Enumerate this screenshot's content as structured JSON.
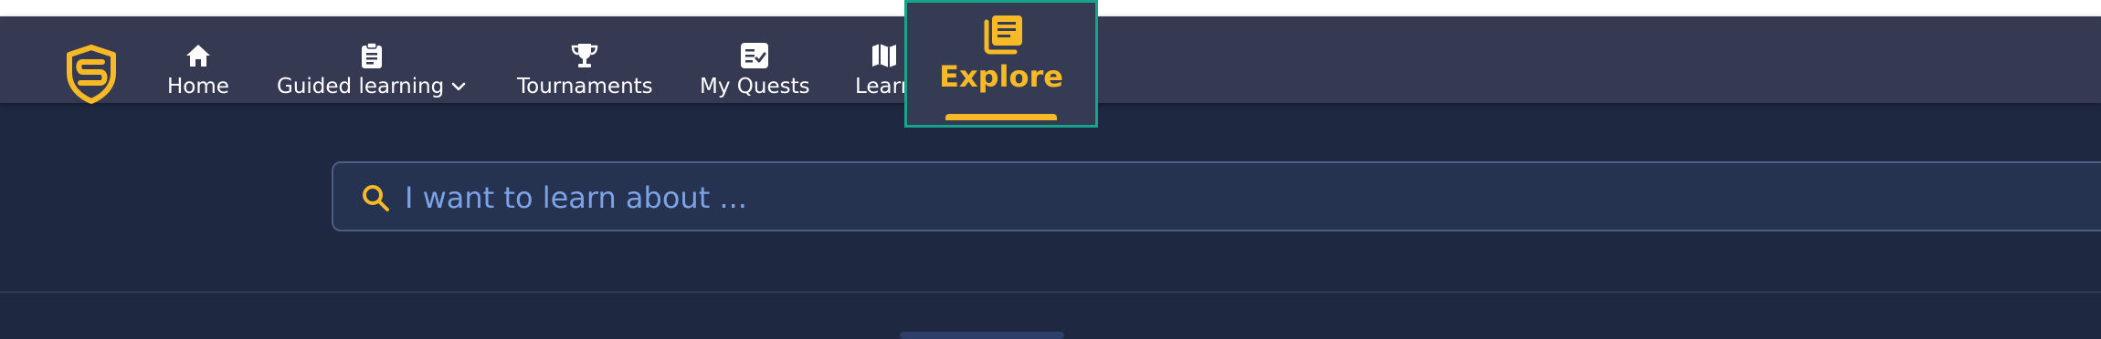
{
  "nav": {
    "items": [
      {
        "label": "Home",
        "icon": "home-icon"
      },
      {
        "label": "Guided learning",
        "icon": "clipboard-icon",
        "has_dropdown": true
      },
      {
        "label": "Tournaments",
        "icon": "trophy-icon"
      },
      {
        "label": "My Quests",
        "icon": "quest-checklist-icon"
      },
      {
        "label": "Learn",
        "icon": "map-icon"
      },
      {
        "label": "Explore",
        "icon": "books-icon",
        "active": true
      }
    ]
  },
  "search": {
    "placeholder": "I want to learn about ...",
    "value": ""
  },
  "colors": {
    "accent": "#f7b926",
    "navbar_bg": "#353a52",
    "page_bg": "#1f2841",
    "highlight_border": "#15a58b",
    "placeholder": "#7ea2e6"
  }
}
